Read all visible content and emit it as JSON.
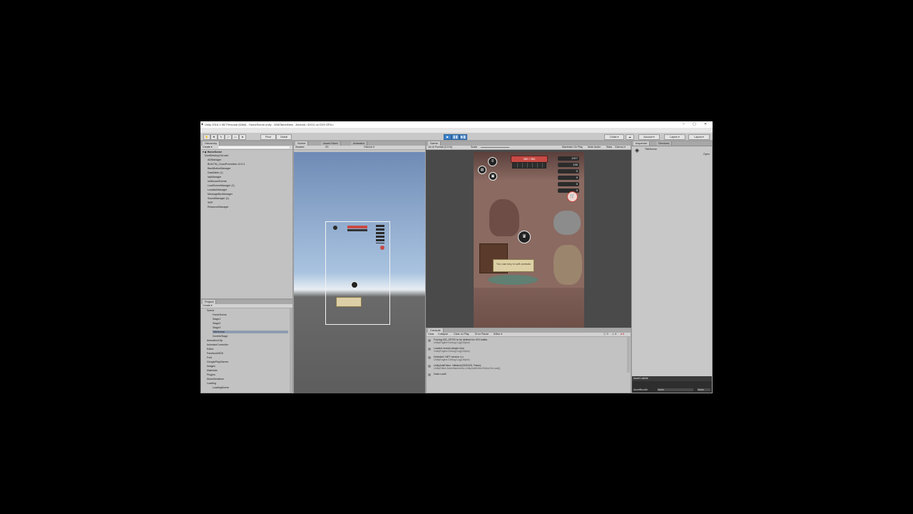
{
  "window": {
    "title": "Unity 2018.1.9f2 Personal (64bit) - HomeScene.unity - WildTamerNew - Android <DX11 on DX9 GPU>",
    "controls": [
      "–",
      "▢",
      "✕"
    ]
  },
  "menu": [
    "File",
    "Edit",
    "Assets",
    "GameObject",
    "Component",
    "DevSimpacker",
    "Facebook",
    "Window",
    "Help"
  ],
  "toolbar": {
    "pivot": "Pivot",
    "global": "Global",
    "collab": "Collab ▾",
    "account": "Account ▾",
    "layers": "Layers ▾",
    "layout": "Layout ▾"
  },
  "hierarchy": {
    "tab": "Hierarchy",
    "create": "Create ▾",
    "scene": "HomeScene",
    "items": [
      "DontDestroyOnLoad",
      "ADManager",
      "BUILTIN_CrossPromotion v3.0.4",
      "BackButtonManager",
      "DataTable (1)",
      "IapManager",
      "InitMouseEvents",
      "LoadSceneManager (1)",
      "LocalizeManager",
      "MessageBoxManager",
      "SoundManager (1)",
      "SRP",
      "ResourceManager"
    ]
  },
  "project": {
    "tab": "Project",
    "create": "Create ▾",
    "items": [
      "Scene",
      "HomeScene",
      "Stage1",
      "Stage2",
      "Stage3",
      "TitleScene",
      "ZombieStage",
      "AnimationClip",
      "AnimatorController",
      "Editor",
      "FacebookSDK",
      "Font",
      "GooglePlayGames",
      "Images",
      "Materials",
      "Plugins",
      "MonoSerializer",
      "Loading",
      "LoadingScene"
    ]
  },
  "scene": {
    "tabs": [
      "Scene",
      "Asset Store",
      "Animator"
    ],
    "shaded": "Shaded",
    "mode": "2D",
    "gizmos": "Gizmos ▾"
  },
  "game": {
    "tab": "Game",
    "resolution": "16:10 Portrait (10:16)",
    "scale": "Scale",
    "options": [
      "Maximize On Play",
      "Mute Audio",
      "Stats",
      "Gizmos ▾"
    ],
    "hp": "350 / 350",
    "counters": [
      "1377",
      "130",
      "0",
      "0",
      "0",
      "0"
    ],
    "tip": "You can key in soft animals"
  },
  "console": {
    "tab": "Console",
    "buttons": [
      "Clear",
      "Collapse",
      "Clear on Play",
      "Error Pause",
      "Editor ▾"
    ],
    "counts": [
      "0",
      "0",
      "0"
    ],
    "lines": [
      {
        "text": "Forcing NO_GPGS to be defined for iOS builds",
        "sub": "UnityEngine.Debug:Log(Object)"
      },
      {
        "text": "Loaded version:single:4ms",
        "sub": "UnityEngine.Debug:Log(Object)"
      },
      {
        "text": "Detected .NET version 4.x",
        "sub": "UnityEngine.Debug:Log(Object)"
      },
      {
        "text": "UnityAdsEditor: Initialize(2930425, False);",
        "sub": "UnityEditor.Advertisements.UnityAdsEditor:EditorOnLoad()"
      },
      {
        "text": "Data Load!",
        "sub": ""
      }
    ]
  },
  "inspector": {
    "tabs": [
      "Inspector",
      "Services"
    ],
    "object": "TitleScene",
    "open": "Open",
    "asset_labels": "Asset Labels",
    "asset_bundle": "AssetBundle",
    "none1": "None",
    "none2": "None"
  },
  "colors": {
    "editor_bg": "#c2c2c2",
    "play_blue": "#3b83cf",
    "hp_red": "#c84a44"
  }
}
